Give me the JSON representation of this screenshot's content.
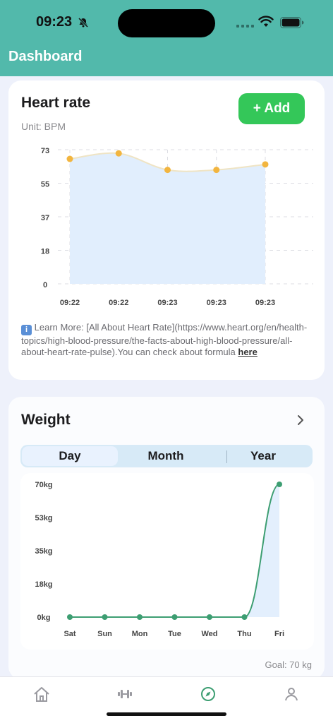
{
  "status": {
    "time": "09:23"
  },
  "header": {
    "title": "Dashboard"
  },
  "heart_rate": {
    "title": "Heart rate",
    "unit": "Unit: BPM",
    "add_label": "+ Add",
    "learn_more": "Learn More: [All About Heart Rate](https://www.heart.org/en/health-topics/high-blood-pressure/the-facts-about-high-blood-pressure/all-about-heart-rate-pulse).You can check about formula",
    "here_label": "here"
  },
  "weight": {
    "title": "Weight",
    "tabs": [
      "Day",
      "Month",
      "Year"
    ],
    "goal": "Goal: 70 kg"
  },
  "tabbar": {
    "items": [
      {
        "icon": "home-icon"
      },
      {
        "icon": "dumbbell-icon"
      },
      {
        "icon": "compass-icon"
      },
      {
        "icon": "profile-icon"
      }
    ]
  },
  "colors": {
    "header": "#52b9ab",
    "accent_green": "#34c759",
    "weight_line": "#3d9e72",
    "hr_point": "#f2b53f"
  },
  "chart_data": [
    {
      "type": "area",
      "title": "Heart rate",
      "x": [
        "09:22",
        "09:22",
        "09:23",
        "09:23",
        "09:23"
      ],
      "y_ticks": [
        "73",
        "55",
        "37",
        "18",
        "0"
      ],
      "ylim": [
        0,
        73
      ],
      "values": [
        68,
        71,
        62,
        62,
        65
      ],
      "grid": true
    },
    {
      "type": "area",
      "title": "Weight",
      "x": [
        "Sat",
        "Sun",
        "Mon",
        "Tue",
        "Wed",
        "Thu",
        "Fri"
      ],
      "y_ticks": [
        "70kg",
        "53kg",
        "35kg",
        "18kg",
        "0kg"
      ],
      "ylim": [
        0,
        70
      ],
      "values": [
        0,
        0,
        0,
        0,
        0,
        0,
        70
      ],
      "grid": false
    }
  ]
}
